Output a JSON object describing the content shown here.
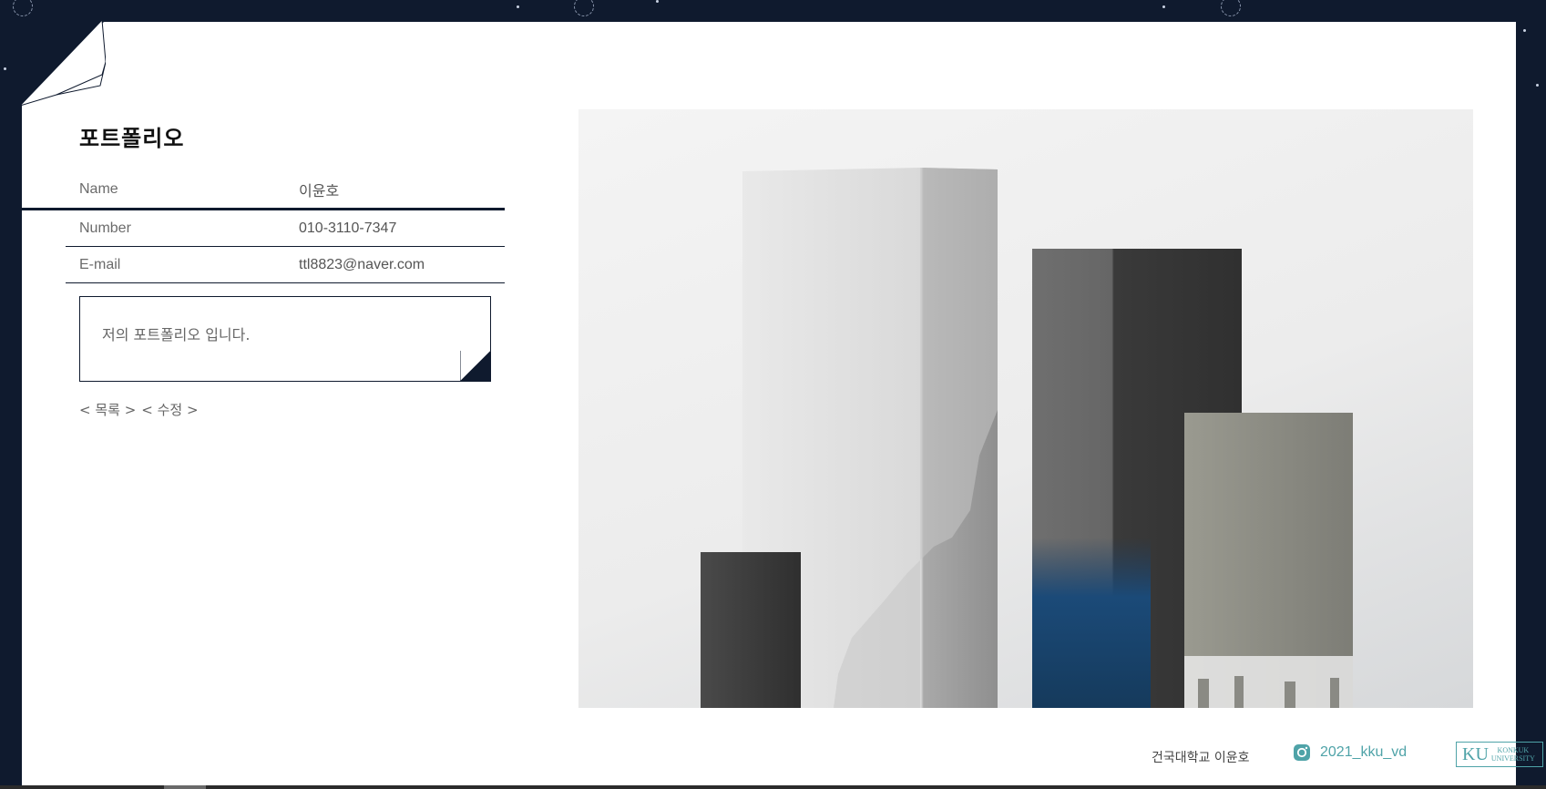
{
  "page": {
    "title": "포트폴리오"
  },
  "info": {
    "name_label": "Name",
    "name_value": "이윤호",
    "number_label": "Number",
    "number_value": "010-3110-7347",
    "email_label": "E-mail",
    "email_value": "ttl8823@naver.com"
  },
  "description": {
    "text": "저의 포트폴리오 입니다."
  },
  "nav": {
    "list_link": "< 목록 >",
    "edit_link": "< 수정 >"
  },
  "footer": {
    "author": "건국대학교 이윤호",
    "instagram_handle": "2021_kku_vd",
    "logo_main": "KU",
    "logo_sub_1": "KONKUK",
    "logo_sub_2": "UNIVERSITY"
  },
  "colors": {
    "background": "#0f1a2e",
    "paper": "#ffffff",
    "accent": "#4fa3a8"
  },
  "icons": {
    "instagram": "instagram-icon"
  }
}
